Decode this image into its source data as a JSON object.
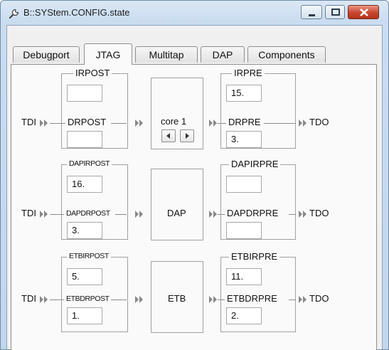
{
  "window": {
    "title": "B::SYStem.CONFIG.state",
    "icon": "wrench-icon",
    "controls": [
      "minimize-icon",
      "maximize-icon",
      "close-icon"
    ]
  },
  "tabs": [
    {
      "label": "Debugport",
      "active": false
    },
    {
      "label": "JTAG",
      "active": true
    },
    {
      "label": "Multitap",
      "active": false
    },
    {
      "label": "DAP",
      "active": false
    },
    {
      "label": "Components",
      "active": false
    }
  ],
  "chain": {
    "tdi": "TDI",
    "tdo": "TDO",
    "rows": [
      {
        "post_ir_label": "IRPOST",
        "post_ir_value": "",
        "post_dr_label": "DRPOST",
        "post_dr_value": "",
        "core_label": "core 1",
        "has_nav": true,
        "pre_ir_label": "IRPRE",
        "pre_ir_value": "15.",
        "pre_dr_label": "DRPRE",
        "pre_dr_value": "3."
      },
      {
        "post_ir_label": "DAPIRPOST",
        "post_ir_value": "16.",
        "post_dr_label": "DAPDRPOST",
        "post_dr_value": "3.",
        "core_label": "DAP",
        "has_nav": false,
        "pre_ir_label": "DAPIRPRE",
        "pre_ir_value": "",
        "pre_dr_label": "DAPDRPRE",
        "pre_dr_value": ""
      },
      {
        "post_ir_label": "ETBIRPOST",
        "post_ir_value": "5.",
        "post_dr_label": "ETBDRPOST",
        "post_dr_value": "1.",
        "core_label": "ETB",
        "has_nav": false,
        "pre_ir_label": "ETBIRPRE",
        "pre_ir_value": "11.",
        "pre_dr_label": "ETBDRPRE",
        "pre_dr_value": "2."
      }
    ]
  }
}
